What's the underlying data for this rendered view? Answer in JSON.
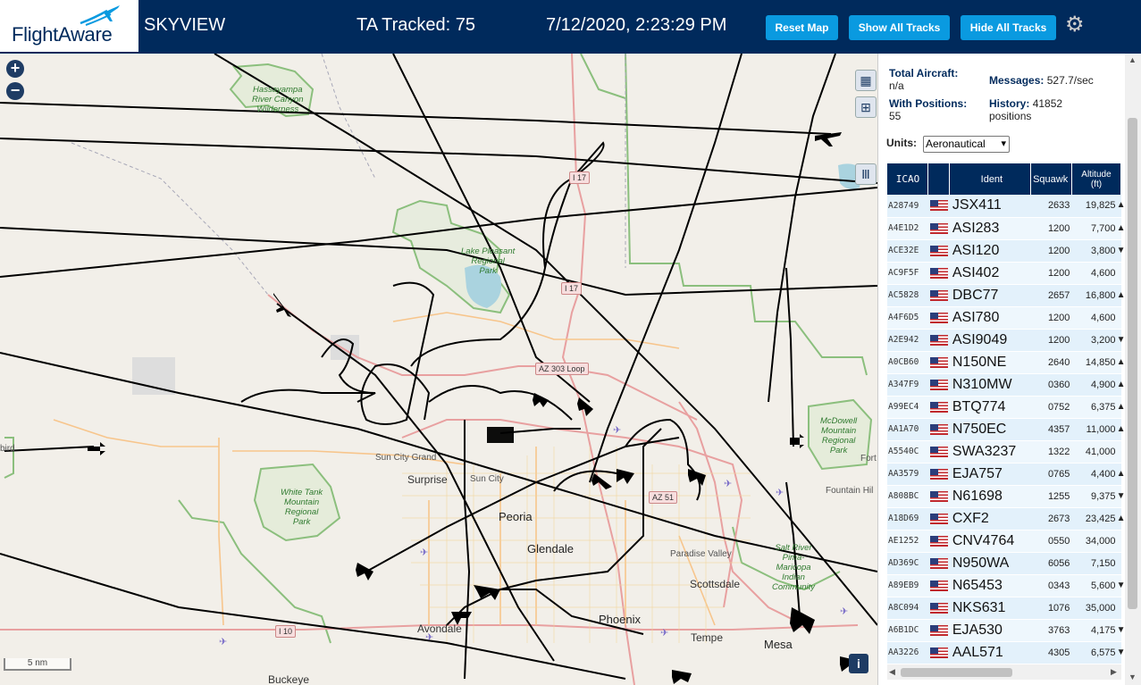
{
  "header": {
    "logo": "FlightAware",
    "app_name": "SKYVIEW",
    "tracked": "TA Tracked: 75",
    "datetime": "7/12/2020, 2:23:29 PM",
    "reset_label": "Reset Map",
    "show_label": "Show All Tracks",
    "hide_label": "Hide All Tracks",
    "gear_icon": "gear-icon"
  },
  "map": {
    "zoom_in": "+",
    "zoom_out": "−",
    "scale": "5 nm",
    "info": "i",
    "labels": {
      "hassayampa": "Hassayampa\nRiver Canyon\nWilderness",
      "lake_pleasant": "Lake Pleasant\nRegional\nPark",
      "white_tank": "White Tank\nMountain\nRegional\nPark",
      "mcdowell": "McDowell\nMountain\nRegional\nPark",
      "salt_river": "Salt River\nPima-\nMaricopa\nIndian\nCommunity",
      "sun_city_grand": "Sun City Grand",
      "surprise": "Surprise",
      "sun_city": "Sun City",
      "peoria": "Peoria",
      "glendale": "Glendale",
      "paradise_valley": "Paradise Valley",
      "scottsdale": "Scottsdale",
      "phoenix": "Phoenix",
      "avondale": "Avondale",
      "tempe": "Tempe",
      "mesa": "Mesa",
      "fountain_hills": "Fountain Hil",
      "buckeye": "Buckeye",
      "fort": "Fort",
      "ird": "bird",
      "i17_north": "I 17",
      "i17_mid": "I 17",
      "az303": "AZ 303 Loop",
      "az51": "AZ 51",
      "i10": "I 10"
    }
  },
  "panel": {
    "total_label": "Total Aircraft:",
    "total_value": "n/a",
    "positions_label": "With Positions:",
    "positions_value": "55",
    "messages_label": "Messages:",
    "messages_value": "527.7/sec",
    "history_label": "History:",
    "history_value": "41852",
    "history_unit": "positions",
    "units_label": "Units:",
    "units_value": "Aeronautical",
    "columns": [
      "ICAO",
      "",
      "Ident",
      "Squawk",
      "Altitude\n(ft)"
    ],
    "rows": [
      {
        "icao": "A28749",
        "ident": "JSX411",
        "squawk": "2633",
        "alt": "19,825",
        "dir": "▲"
      },
      {
        "icao": "A4E1D2",
        "ident": "ASI283",
        "squawk": "1200",
        "alt": "7,700",
        "dir": "▲"
      },
      {
        "icao": "ACE32E",
        "ident": "ASI120",
        "squawk": "1200",
        "alt": "3,800",
        "dir": "▼"
      },
      {
        "icao": "AC9F5F",
        "ident": "ASI402",
        "squawk": "1200",
        "alt": "4,600",
        "dir": ""
      },
      {
        "icao": "AC5828",
        "ident": "DBC77",
        "squawk": "2657",
        "alt": "16,800",
        "dir": "▲"
      },
      {
        "icao": "A4F6D5",
        "ident": "ASI780",
        "squawk": "1200",
        "alt": "4,600",
        "dir": ""
      },
      {
        "icao": "A2E942",
        "ident": "ASI9049",
        "squawk": "1200",
        "alt": "3,200",
        "dir": "▼"
      },
      {
        "icao": "A0CB60",
        "ident": "N150NE",
        "squawk": "2640",
        "alt": "14,850",
        "dir": "▲"
      },
      {
        "icao": "A347F9",
        "ident": "N310MW",
        "squawk": "0360",
        "alt": "4,900",
        "dir": "▲"
      },
      {
        "icao": "A99EC4",
        "ident": "BTQ774",
        "squawk": "0752",
        "alt": "6,375",
        "dir": "▲"
      },
      {
        "icao": "AA1A70",
        "ident": "N750EC",
        "squawk": "4357",
        "alt": "11,000",
        "dir": "▲"
      },
      {
        "icao": "A5540C",
        "ident": "SWA3237",
        "squawk": "1322",
        "alt": "41,000",
        "dir": ""
      },
      {
        "icao": "AA3579",
        "ident": "EJA757",
        "squawk": "0765",
        "alt": "4,400",
        "dir": "▲"
      },
      {
        "icao": "A808BC",
        "ident": "N61698",
        "squawk": "1255",
        "alt": "9,375",
        "dir": "▼"
      },
      {
        "icao": "A18D69",
        "ident": "CXF2",
        "squawk": "2673",
        "alt": "23,425",
        "dir": "▲"
      },
      {
        "icao": "AE1252",
        "ident": "CNV4764",
        "squawk": "0550",
        "alt": "34,000",
        "dir": ""
      },
      {
        "icao": "AD369C",
        "ident": "N950WA",
        "squawk": "6056",
        "alt": "7,150",
        "dir": ""
      },
      {
        "icao": "A89EB9",
        "ident": "N65453",
        "squawk": "0343",
        "alt": "5,600",
        "dir": "▼"
      },
      {
        "icao": "A8C094",
        "ident": "NKS631",
        "squawk": "1076",
        "alt": "35,000",
        "dir": ""
      },
      {
        "icao": "A6B1DC",
        "ident": "EJA530",
        "squawk": "3763",
        "alt": "4,175",
        "dir": "▼"
      },
      {
        "icao": "AA3226",
        "ident": "AAL571",
        "squawk": "4305",
        "alt": "6,575",
        "dir": "▼"
      }
    ]
  },
  "colors": {
    "header_bg": "#002a5c",
    "button_bg": "#0a9ae0",
    "map_bg": "#f2efe9",
    "park_green": "#2f7a2f",
    "row_bg": "#e3f1fb"
  }
}
